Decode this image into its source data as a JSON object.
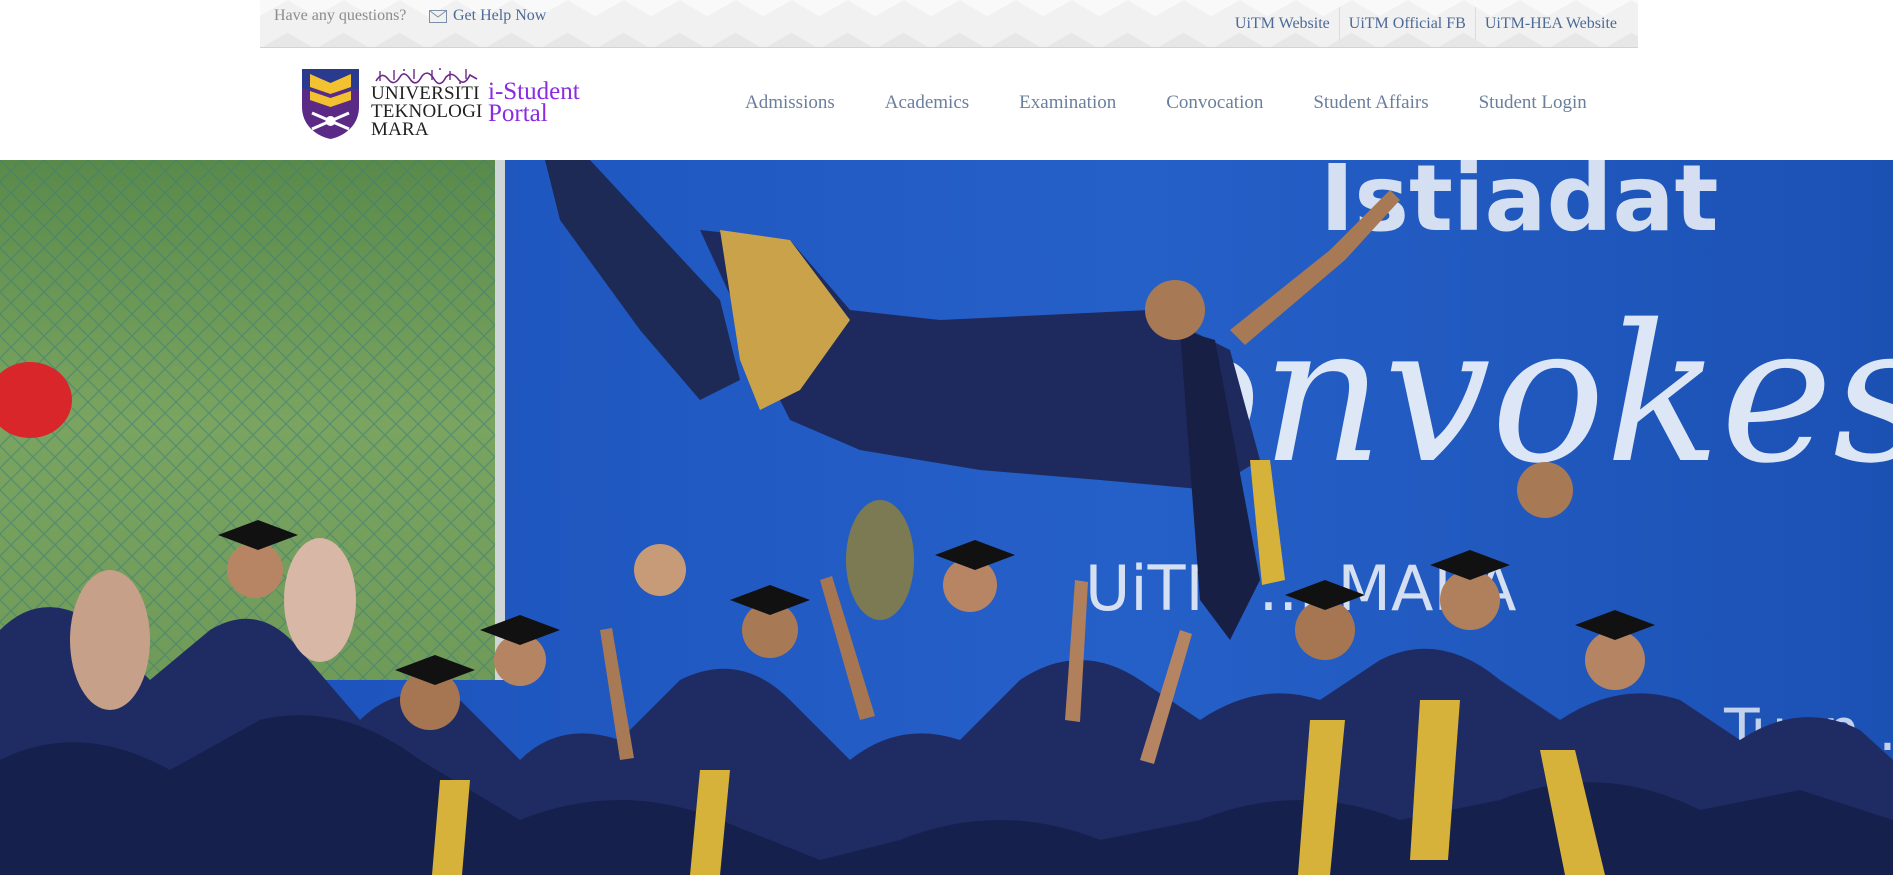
{
  "topbar": {
    "question_text": "Have any questions?",
    "help_label": "Get Help Now",
    "links": [
      {
        "label": "UiTM Website"
      },
      {
        "label": "UiTM Official FB"
      },
      {
        "label": "UiTM-HEA Website"
      }
    ]
  },
  "logo": {
    "university_line1": "UNIVERSITI",
    "university_line2": "TEKNOLOGI",
    "university_line3": "MARA",
    "portal_line1": "i-Student",
    "portal_line2": "Portal"
  },
  "nav": {
    "items": [
      {
        "label": "Admissions"
      },
      {
        "label": "Academics"
      },
      {
        "label": "Examination"
      },
      {
        "label": "Convocation"
      },
      {
        "label": "Student Affairs"
      },
      {
        "label": "Student Login"
      }
    ]
  },
  "hero": {
    "banner_text_top": "Istiadat",
    "banner_text_script": "Konvokesyen",
    "banner_text_mid": "UiTM ... MARA",
    "banner_text_low": "...ung Tuan..."
  },
  "colors": {
    "link_blue": "#4c6a96",
    "nav_blue_gray": "#6a7f9c",
    "portal_purple": "#8a2be2",
    "hero_banner_blue": "#1b4aa8",
    "gown_navy": "#1e2a5e",
    "gown_gold": "#d6b23a"
  }
}
